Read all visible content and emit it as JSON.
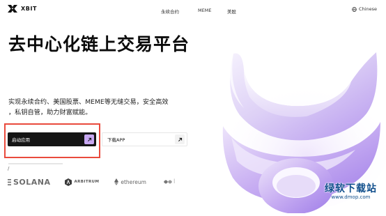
{
  "brand": {
    "name": "XBIT"
  },
  "nav": {
    "links": [
      "永续合约",
      "MEME",
      "美股"
    ],
    "language": "Chinese"
  },
  "hero": {
    "title": "去中心化链上交易平台",
    "description_line1": "实现永续合约、美国股票、MEME等无缝交易，安全高效",
    "description_line2": "，私钥自管，助力财富赋能。"
  },
  "cta": {
    "launch_label": "启动应用",
    "download_label": "下载APP"
  },
  "divider_text": "/",
  "partners": {
    "solana": "SOLANA",
    "arbitrum": "ARBITRUM",
    "ethereum": "ethereum",
    "fourth_partial": "I"
  },
  "watermark": {
    "main": "绿软下载站",
    "sub": "www.dmop.com"
  },
  "colors": {
    "launch_bg": "#151515",
    "launch_arrow_bg": "#c7a8f2",
    "highlight_border": "#e94a3c",
    "art_purple": "#b89cf0",
    "watermark": "#0e4d8b"
  }
}
